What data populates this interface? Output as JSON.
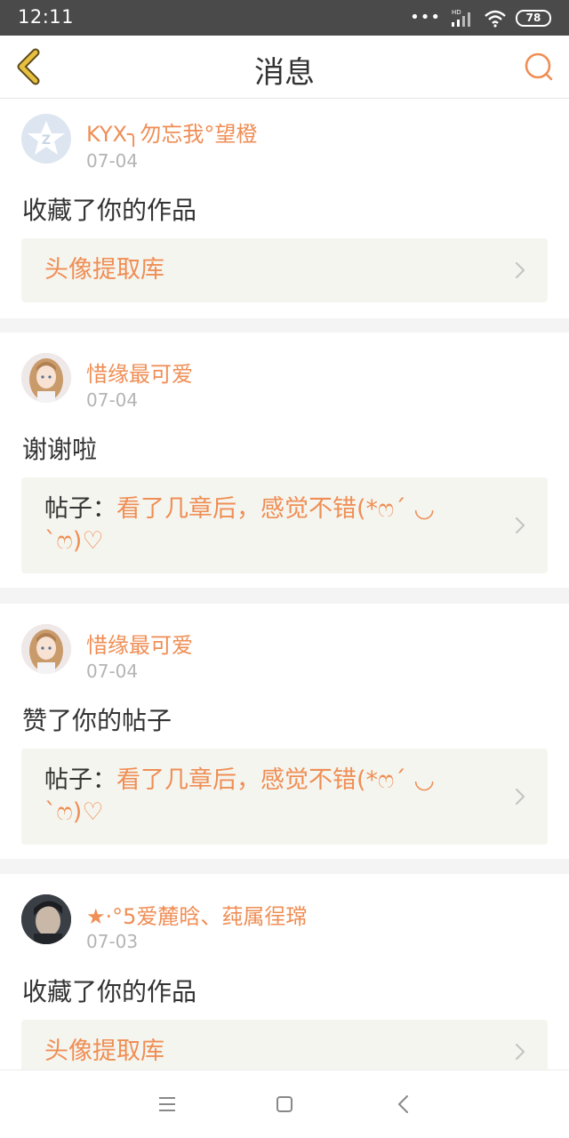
{
  "status_bar": {
    "time": "12:11",
    "network_label": "HD",
    "battery": "78"
  },
  "header": {
    "title": "消息"
  },
  "colors": {
    "accent": "#ef8e55",
    "back_icon": "#e8c040"
  },
  "notifications": [
    {
      "username": "KYX╮勿忘我°望橙",
      "date": "07-04",
      "action": "收藏了你的作品",
      "ref_prefix": "",
      "ref_text": "头像提取库",
      "avatar": "qq-default-avatar"
    },
    {
      "username": "惜缘最可爱",
      "date": "07-04",
      "action": "谢谢啦",
      "ref_prefix": "帖子：",
      "ref_text": "看了几章后，感觉不错(*ෆ´ ◡ `ෆ)♡",
      "avatar": "anime-girl-avatar"
    },
    {
      "username": "惜缘最可爱",
      "date": "07-04",
      "action": "赞了你的帖子",
      "ref_prefix": "帖子：",
      "ref_text": "看了几章后，感觉不错(*ෆ´ ◡ `ෆ)♡",
      "avatar": "anime-girl-avatar"
    },
    {
      "username": "★·°5爱麓晗、莼属徎瑺",
      "date": "07-03",
      "action": "收藏了你的作品",
      "ref_prefix": "",
      "ref_text": "头像提取库",
      "avatar": "dark-portrait-avatar"
    }
  ]
}
